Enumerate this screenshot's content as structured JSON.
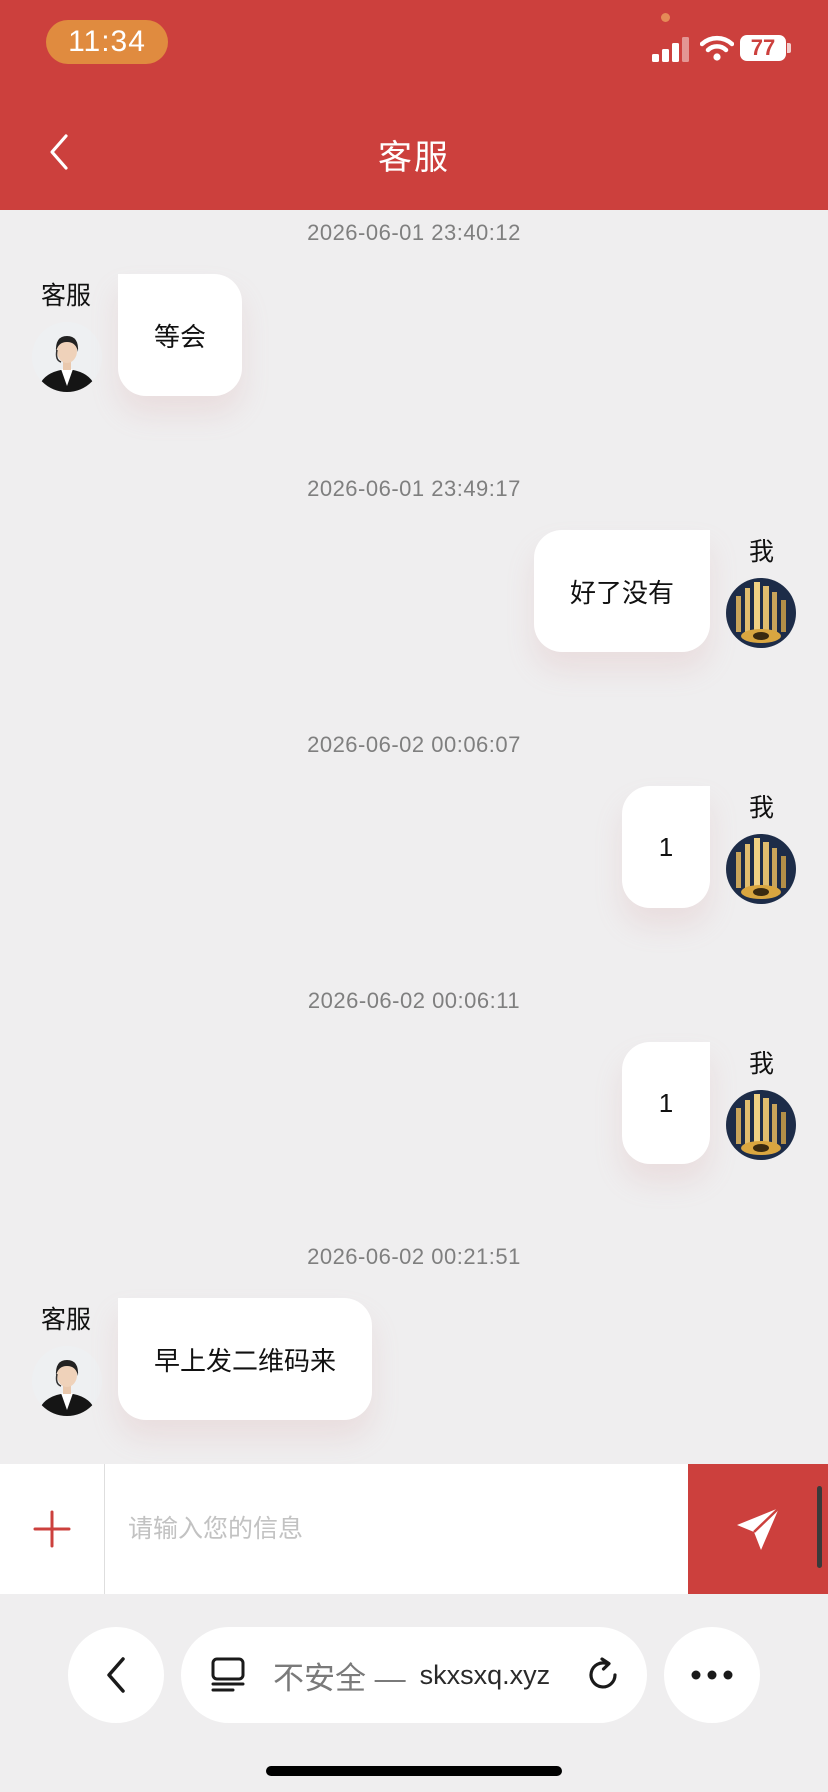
{
  "status_bar": {
    "time": "11:34",
    "battery": "77"
  },
  "header": {
    "title": "客服"
  },
  "messages": [
    {
      "timestamp": "2026-06-01 23:40:12",
      "sender": "客服",
      "side": "left",
      "text": "等会"
    },
    {
      "timestamp": "2026-06-01 23:49:17",
      "sender": "我",
      "side": "right",
      "text": "好了没有"
    },
    {
      "timestamp": "2026-06-02 00:06:07",
      "sender": "我",
      "side": "right",
      "text": "1"
    },
    {
      "timestamp": "2026-06-02 00:06:11",
      "sender": "我",
      "side": "right",
      "text": "1"
    },
    {
      "timestamp": "2026-06-02 00:21:51",
      "sender": "客服",
      "side": "left",
      "text": "早上发二维码来"
    }
  ],
  "input": {
    "placeholder": "请输入您的信息",
    "value": ""
  },
  "browser": {
    "insecure_label": "不安全 —",
    "domain": "skxsxq.xyz"
  },
  "colors": {
    "brand_red": "#cc403d",
    "time_pill": "#e08b3f",
    "background": "#efeeef"
  },
  "icons": {
    "back": "chevron-left-icon",
    "add": "plus-icon",
    "send": "paper-plane-icon",
    "reader": "reader-icon",
    "reload": "reload-icon",
    "more": "more-icon"
  }
}
